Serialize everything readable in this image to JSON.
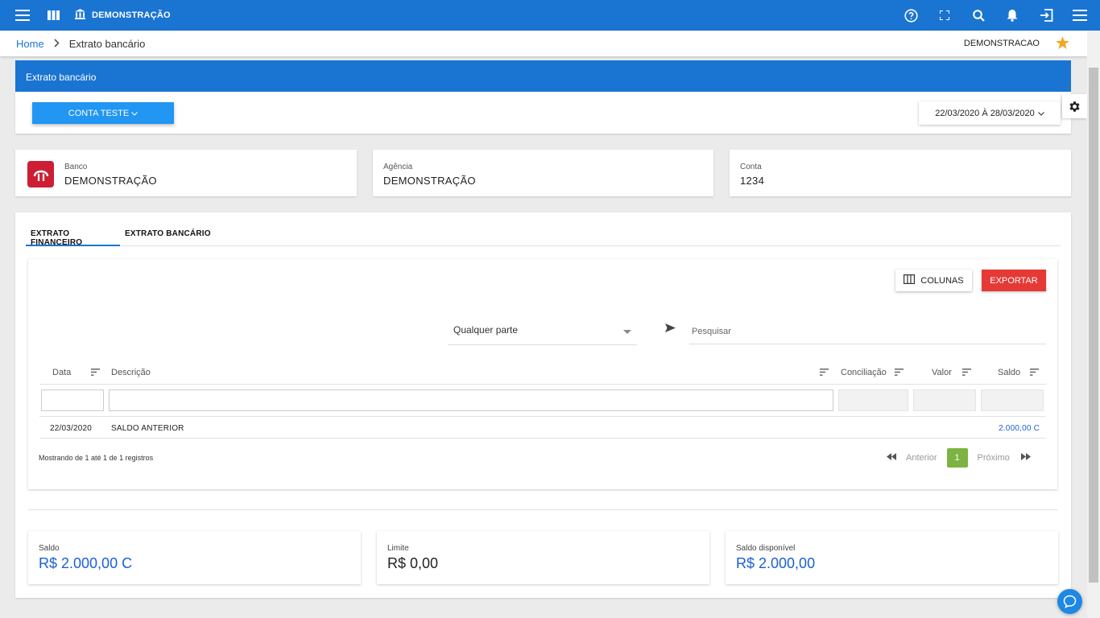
{
  "topbar": {
    "title": "DEMONSTRAÇÃO"
  },
  "breadcrumb": {
    "home": "Home",
    "current": "Extrato bancário",
    "company": "DEMONSTRACAO"
  },
  "page": {
    "header_title": "Extrato bancário",
    "account_button": "CONTA TESTE",
    "date_range": "22/03/2020 À 28/03/2020"
  },
  "info": {
    "bank_label": "Banco",
    "bank_value": "DEMONSTRAÇÃO",
    "agency_label": "Agência",
    "agency_value": "DEMONSTRAÇÃO",
    "account_label": "Conta",
    "account_value": "1234"
  },
  "tabs": [
    "EXTRATO FINANCEIRO",
    "EXTRATO BANCÁRIO"
  ],
  "toolbar": {
    "columns_label": "COLUNAS",
    "export_label": "EXPORTAR"
  },
  "search": {
    "mode": "Qualquer parte",
    "placeholder": "Pesquisar"
  },
  "table": {
    "headers": [
      "Data",
      "Descrição",
      "Conciliação",
      "Valor",
      "Saldo"
    ],
    "rows": [
      {
        "date": "22/03/2020",
        "description": "SALDO ANTERIOR",
        "reconciliation": "",
        "value": "",
        "balance": "2.000,00 C"
      }
    ]
  },
  "pagination": {
    "showing": "Mostrando de 1 até 1 de 1 registros",
    "previous": "Anterior",
    "page": "1",
    "next": "Próximo"
  },
  "summary": {
    "balance_label": "Saldo",
    "balance_value": "R$ 2.000,00 C",
    "limit_label": "Limite",
    "limit_value": "R$ 0,00",
    "available_label": "Saldo disponível",
    "available_value": "R$ 2.000,00"
  },
  "colors": {
    "primary": "#1a74d2",
    "accent_button": "#2196f3",
    "export": "#e53935",
    "page_active": "#7cb342",
    "money_blue": "#1a5fd6",
    "star": "#f5a623",
    "bank_logo": "#cc1f36"
  }
}
